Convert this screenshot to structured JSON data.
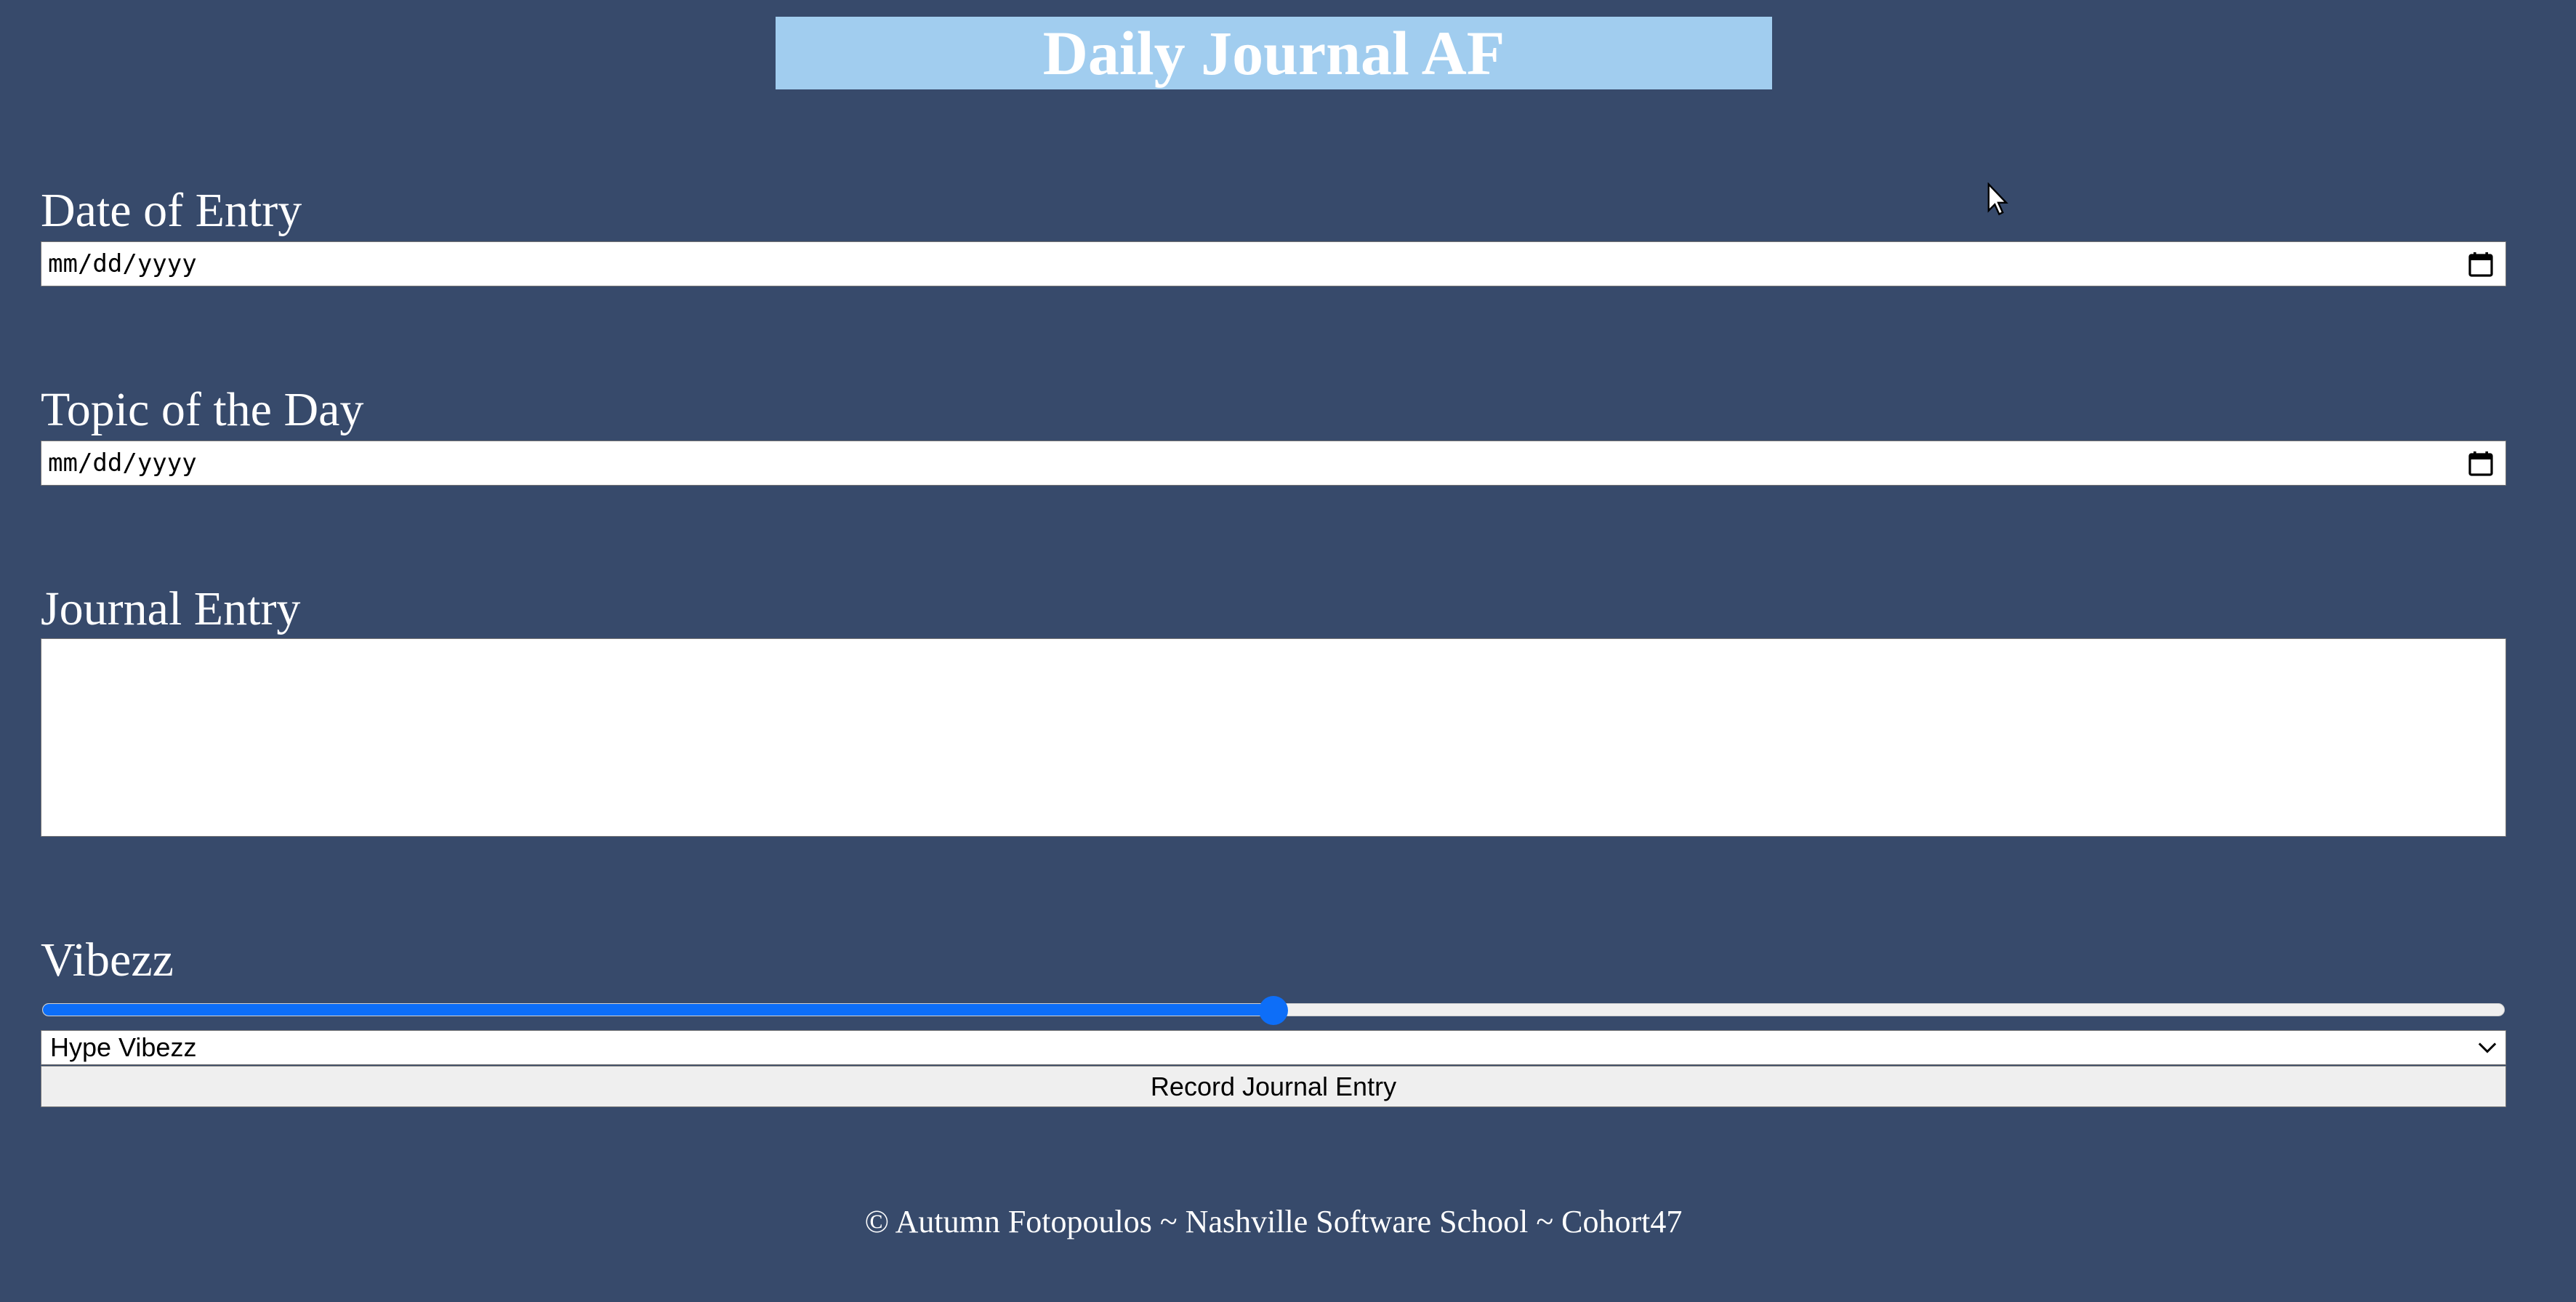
{
  "header": {
    "title": "Daily Journal AF"
  },
  "form": {
    "date": {
      "label": "Date of Entry",
      "placeholder": "mm/dd/yyyy"
    },
    "topic": {
      "label": "Topic of the Day",
      "placeholder": "mm/dd/yyyy"
    },
    "entry": {
      "label": "Journal Entry",
      "value": ""
    },
    "mood": {
      "label": "Vibezz",
      "slider_fraction": 0.5,
      "selected": "Hype Vibezz"
    },
    "submit_label": "Record Journal Entry"
  },
  "footer": {
    "text": "© Autumn Fotopoulos ~ Nashville Software School ~ Cohort47"
  },
  "colors": {
    "background": "#374A6B",
    "header_background": "#A1CDEF",
    "slider_accent": "#0D6EF8"
  },
  "icons": {
    "date_picker": "calendar-icon",
    "select": "chevron-down-icon",
    "cursor": "mouse-pointer-icon"
  }
}
